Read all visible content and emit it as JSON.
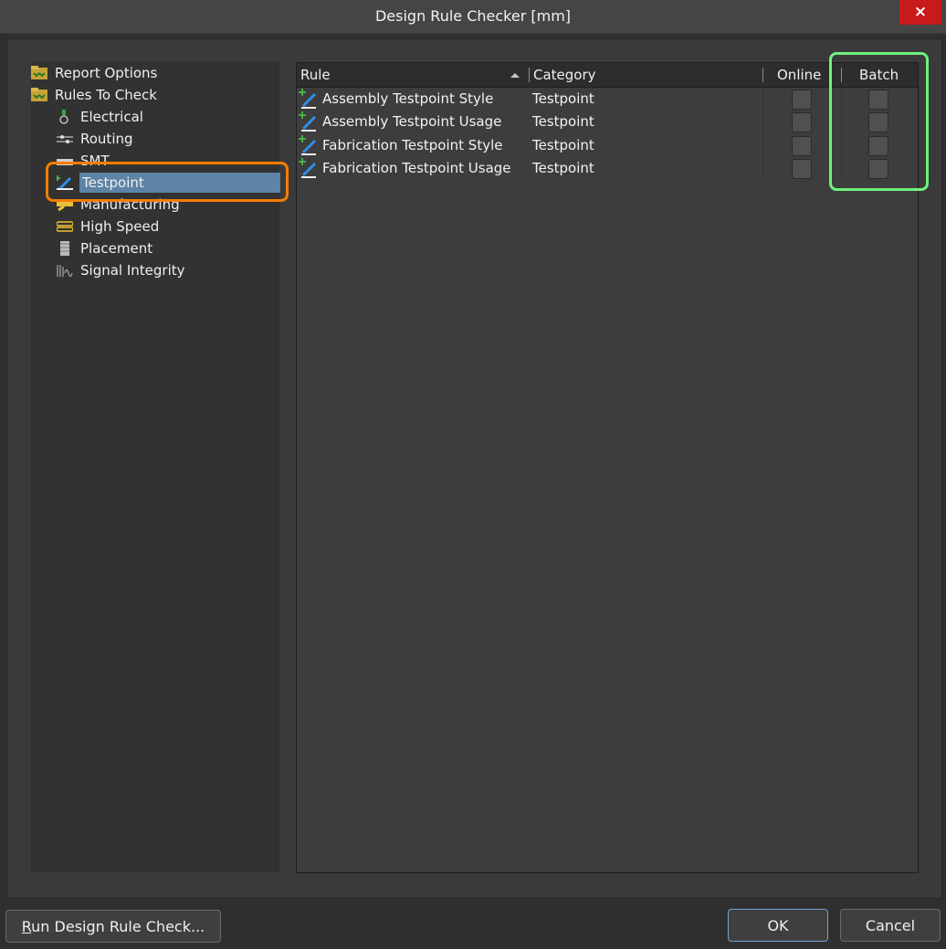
{
  "window": {
    "title": "Design Rule Checker [mm]",
    "close_icon": "×"
  },
  "tree": {
    "items": [
      {
        "label": "Report Options",
        "icon": "folder-icon"
      },
      {
        "label": "Rules To Check",
        "icon": "folder-icon"
      },
      {
        "label": "Electrical",
        "icon": "electrical-icon"
      },
      {
        "label": "Routing",
        "icon": "routing-icon"
      },
      {
        "label": "SMT",
        "icon": "smt-icon"
      },
      {
        "label": "Testpoint",
        "icon": "testpoint-icon",
        "selected": true
      },
      {
        "label": "Manufacturing",
        "icon": "manufacturing-icon"
      },
      {
        "label": "High Speed",
        "icon": "high-speed-icon"
      },
      {
        "label": "Placement",
        "icon": "placement-icon"
      },
      {
        "label": "Signal Integrity",
        "icon": "signal-integrity-icon"
      }
    ]
  },
  "grid": {
    "columns": {
      "rule": "Rule",
      "category": "Category",
      "online": "Online",
      "batch": "Batch"
    },
    "rows": [
      {
        "rule": "Assembly Testpoint Style",
        "category": "Testpoint",
        "online": false,
        "batch": false
      },
      {
        "rule": "Assembly Testpoint Usage",
        "category": "Testpoint",
        "online": false,
        "batch": false
      },
      {
        "rule": "Fabrication Testpoint Style",
        "category": "Testpoint",
        "online": false,
        "batch": false
      },
      {
        "rule": "Fabrication Testpoint Usage",
        "category": "Testpoint",
        "online": false,
        "batch": false
      }
    ]
  },
  "buttons": {
    "run_accel": "R",
    "run_rest": "un Design Rule Check...",
    "ok": "OK",
    "cancel": "Cancel"
  },
  "colors": {
    "highlight_orange": "#f57c00",
    "highlight_green": "#6df27c",
    "selection": "#5d83a6",
    "close_red": "#c81a1a"
  }
}
